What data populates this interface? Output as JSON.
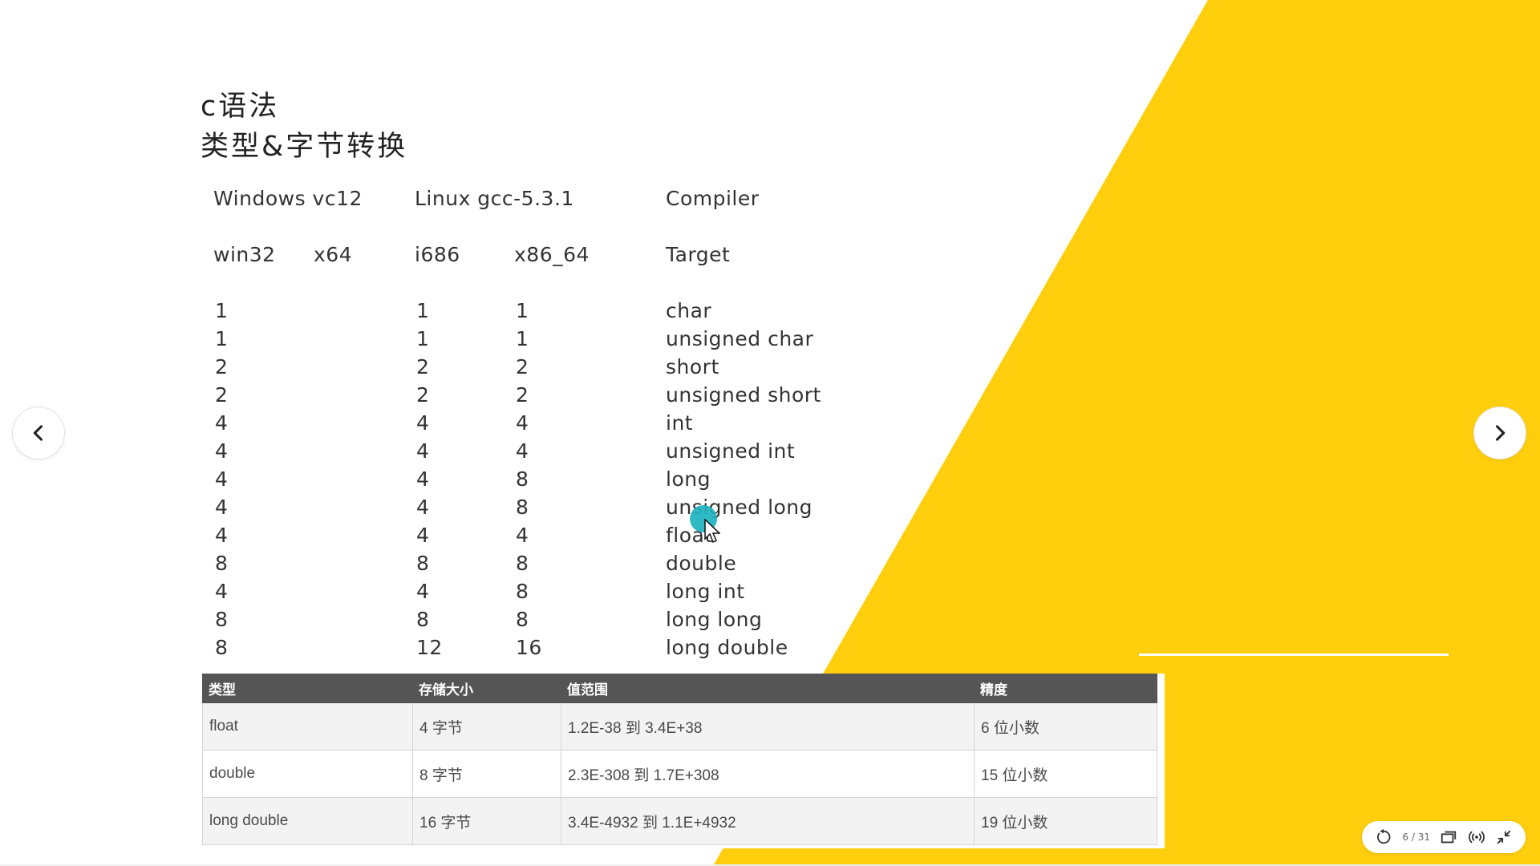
{
  "slide": {
    "title_line1": "c语法",
    "title_line2": "类型&字节转换",
    "compiler_headers": [
      "Windows vc12",
      "Linux gcc-5.3.1",
      "Compiler"
    ],
    "target_headers": [
      "win32",
      "x64",
      "i686",
      "x86_64",
      "Target"
    ],
    "rows": [
      {
        "win32": "1",
        "i686": "1",
        "x86_64": "1",
        "type": "char"
      },
      {
        "win32": "1",
        "i686": "1",
        "x86_64": "1",
        "type": "unsigned char"
      },
      {
        "win32": "2",
        "i686": "2",
        "x86_64": "2",
        "type": "short"
      },
      {
        "win32": "2",
        "i686": "2",
        "x86_64": "2",
        "type": "unsigned short"
      },
      {
        "win32": "4",
        "i686": "4",
        "x86_64": "4",
        "type": "int"
      },
      {
        "win32": "4",
        "i686": "4",
        "x86_64": "4",
        "type": "unsigned int"
      },
      {
        "win32": "4",
        "i686": "4",
        "x86_64": "8",
        "type": "long"
      },
      {
        "win32": "4",
        "i686": "4",
        "x86_64": "8",
        "type": "unsigned long"
      },
      {
        "win32": "4",
        "i686": "4",
        "x86_64": "4",
        "type": "float"
      },
      {
        "win32": "8",
        "i686": "8",
        "x86_64": "8",
        "type": "double"
      },
      {
        "win32": "4",
        "i686": "4",
        "x86_64": "8",
        "type": "long int"
      },
      {
        "win32": "8",
        "i686": "8",
        "x86_64": "8",
        "type": "long long"
      },
      {
        "win32": "8",
        "i686": "12",
        "x86_64": "16",
        "type": "long double"
      }
    ],
    "float_table": {
      "headers": [
        "类型",
        "存储大小",
        "值范围",
        "精度"
      ],
      "rows": [
        [
          "float",
          "4 字节",
          "1.2E-38 到 3.4E+38",
          "6 位小数"
        ],
        [
          "double",
          "8 字节",
          "2.3E-308 到 1.7E+308",
          "15 位小数"
        ],
        [
          "long double",
          "16 字节",
          "3.4E-4932 到 1.1E+4932",
          "19 位小数"
        ]
      ]
    }
  },
  "navigation": {
    "prev_icon": "chevron-left-icon",
    "next_icon": "chevron-right-icon"
  },
  "toolbar": {
    "page_counter": "6 / 31",
    "icons": [
      "replay-icon",
      "window-icon",
      "broadcast-icon",
      "exit-fullscreen-icon"
    ]
  },
  "colors": {
    "accent_yellow": "#ffcf0d",
    "header_gray": "#555555",
    "cursor_teal": "#20b2c0"
  }
}
